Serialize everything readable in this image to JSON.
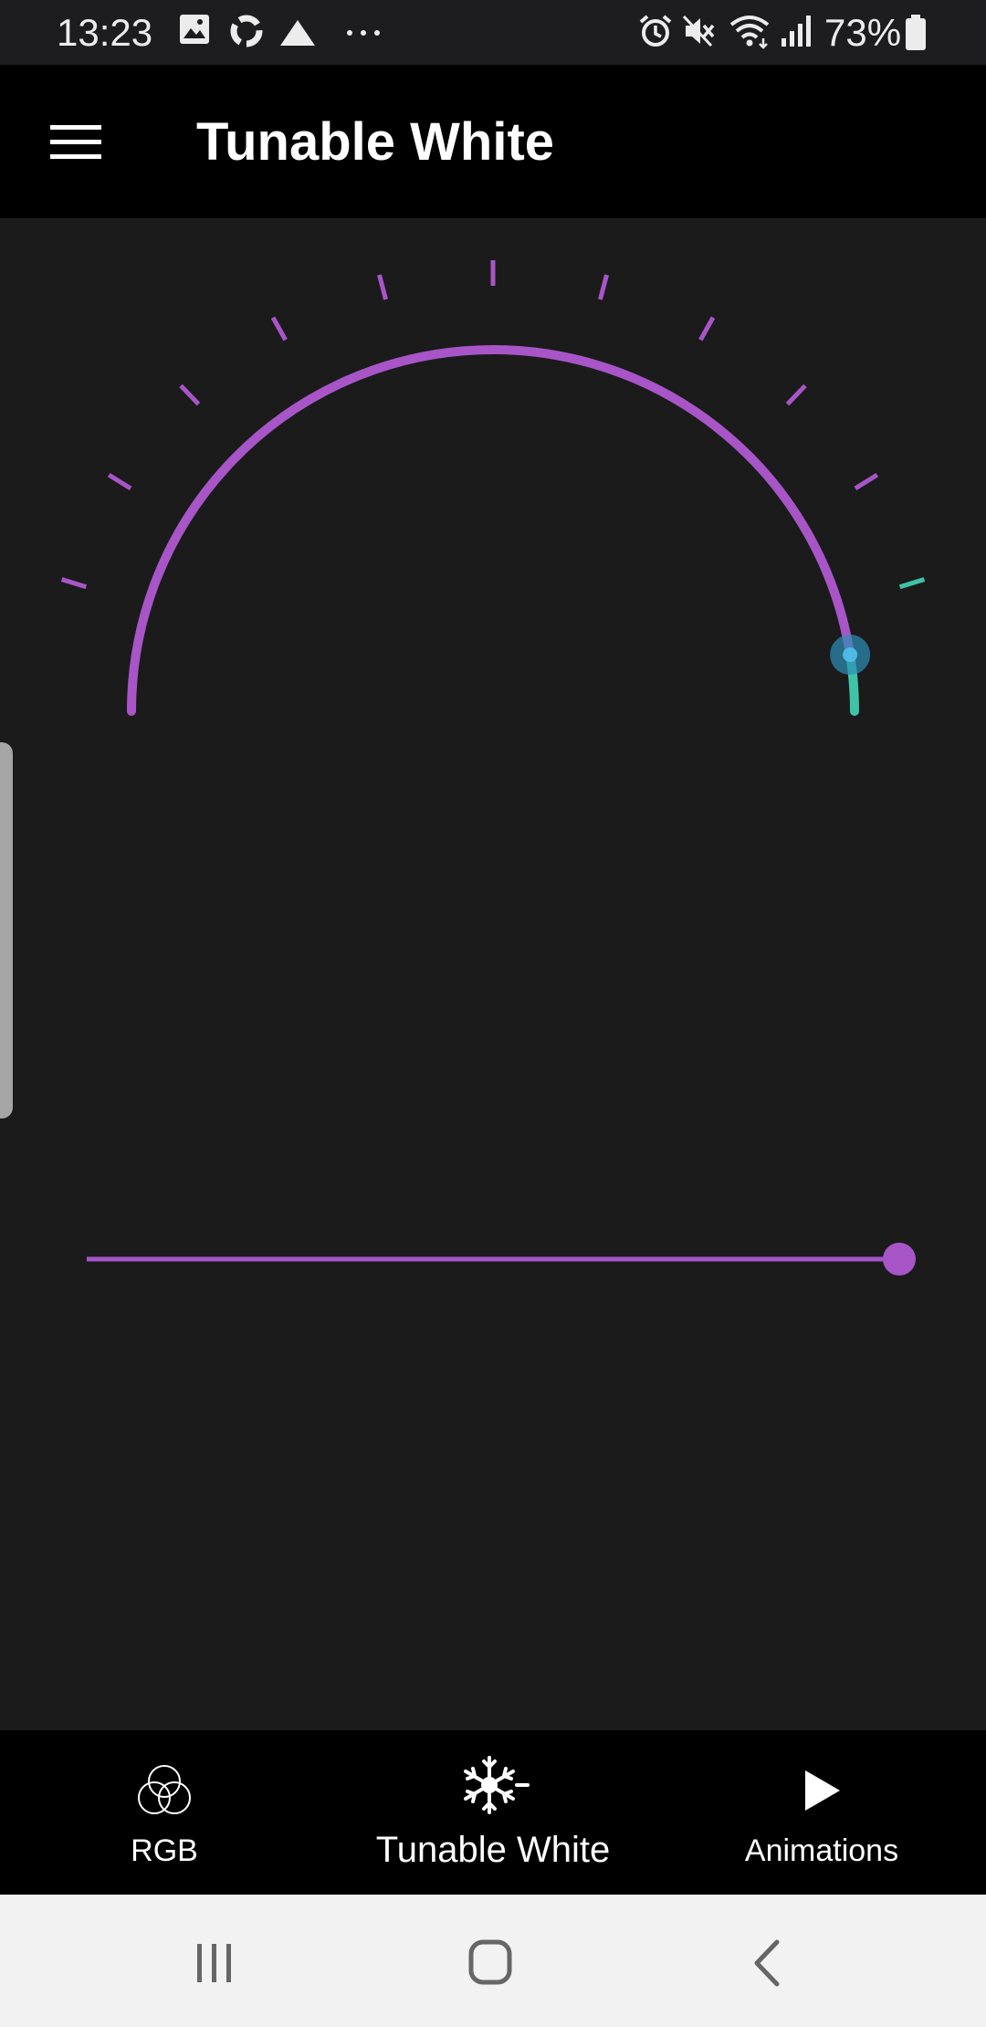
{
  "status_bar": {
    "time": "13:23",
    "battery_percent": "73%",
    "icons": [
      "image-icon",
      "sync-icon",
      "drive-icon",
      "more-dots-icon",
      "alarm-icon",
      "mute-icon",
      "wifi-icon",
      "signal-icon",
      "battery-icon"
    ]
  },
  "app_bar": {
    "title": "Tunable White",
    "menu_icon": "hamburger-menu-icon"
  },
  "dial": {
    "arc_color": "#a855c8",
    "warm_segment_color": "#3fc3a6",
    "knob_color": "#2c8fb8",
    "tick_count": 11,
    "value_fraction": 0.95
  },
  "brightness_slider": {
    "color": "#a855c8",
    "value_fraction": 1.0
  },
  "bottom_nav": {
    "items": [
      {
        "label": "RGB",
        "icon": "rgb-circles-icon"
      },
      {
        "label": "Tunable White",
        "icon": "snowflake-sun-icon",
        "selected": true
      },
      {
        "label": "Animations",
        "icon": "play-icon"
      }
    ]
  },
  "system_nav": {
    "buttons": [
      "recent-apps-icon",
      "home-icon",
      "back-icon"
    ]
  },
  "colors": {
    "background": "#1b1b1c",
    "bars": "#000000",
    "accent": "#a855c8",
    "teal": "#3fc3a6"
  }
}
